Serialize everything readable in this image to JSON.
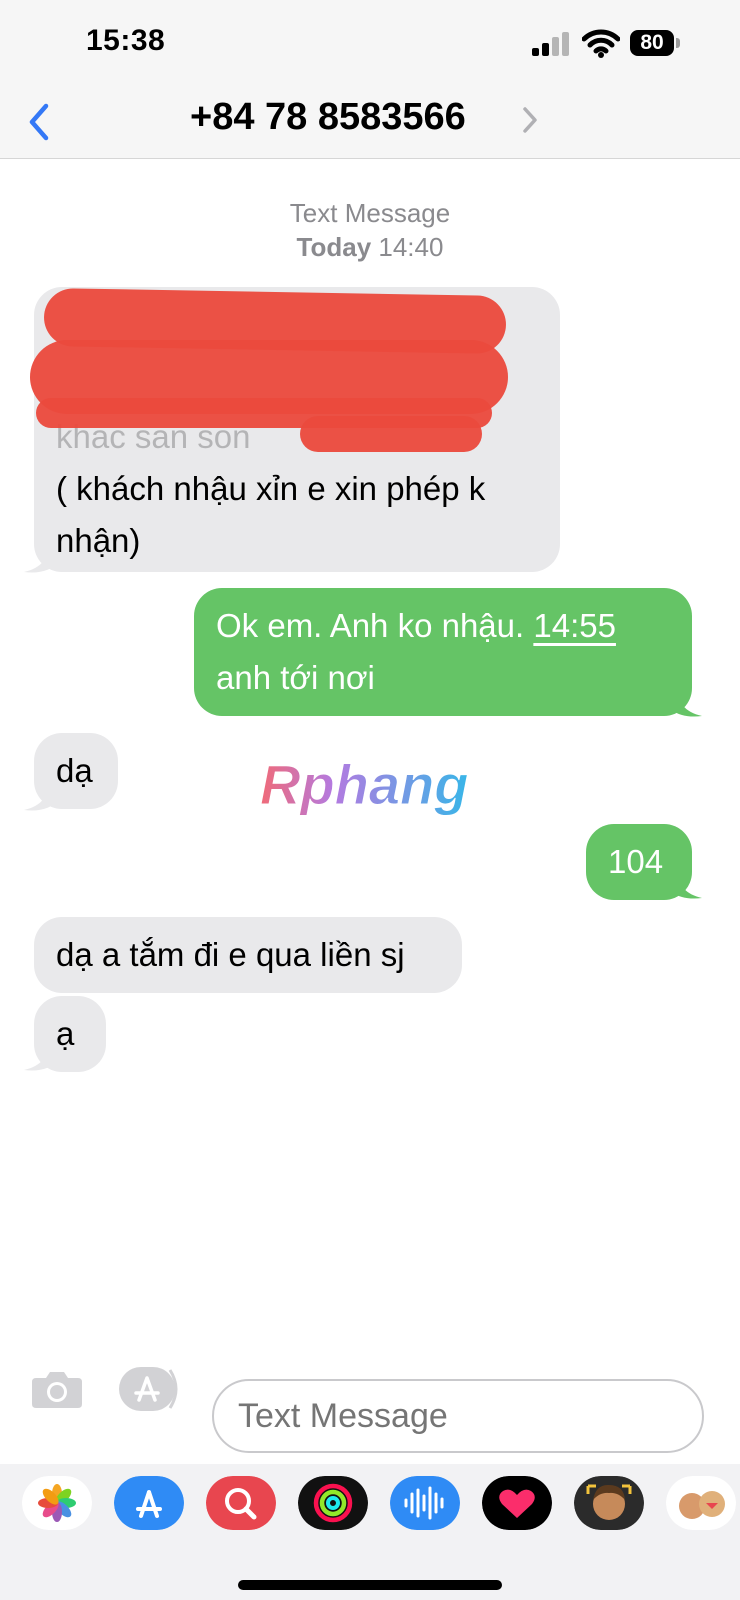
{
  "status_bar": {
    "time": "15:38",
    "battery": "80"
  },
  "nav": {
    "contact": "+84 78 8583566"
  },
  "thread": {
    "service_label": "Text Message",
    "date_prefix": "Today",
    "date_time": "14:40"
  },
  "messages": [
    {
      "direction": "incoming",
      "visible_lines": [
        "( khách nhậu xỉn e xin phép k",
        "nhận)"
      ],
      "partially_obscured": "khac   san son"
    },
    {
      "direction": "outgoing",
      "line1_a": "Ok em. Anh ko nhậu.",
      "line1_b": "14:55",
      "line2": "anh tới nơi"
    },
    {
      "direction": "incoming",
      "text": "dạ"
    },
    {
      "direction": "outgoing",
      "text": "104"
    },
    {
      "direction": "incoming",
      "text": "dạ a tắm đi e qua liền sj"
    },
    {
      "direction": "incoming",
      "text": "ạ"
    }
  ],
  "watermark": "Rphang",
  "compose": {
    "placeholder": "Text Message"
  },
  "app_drawer": [
    "photos-icon",
    "app-store-icon",
    "images-search-icon",
    "activity-icon",
    "audio-message-icon",
    "digital-touch-icon",
    "memoji-icon",
    "memoji-stickers-icon"
  ],
  "colors": {
    "outgoing": "#65c466",
    "incoming": "#e9e9eb",
    "accent": "#3478f6",
    "redaction": "#ea4a3d"
  }
}
